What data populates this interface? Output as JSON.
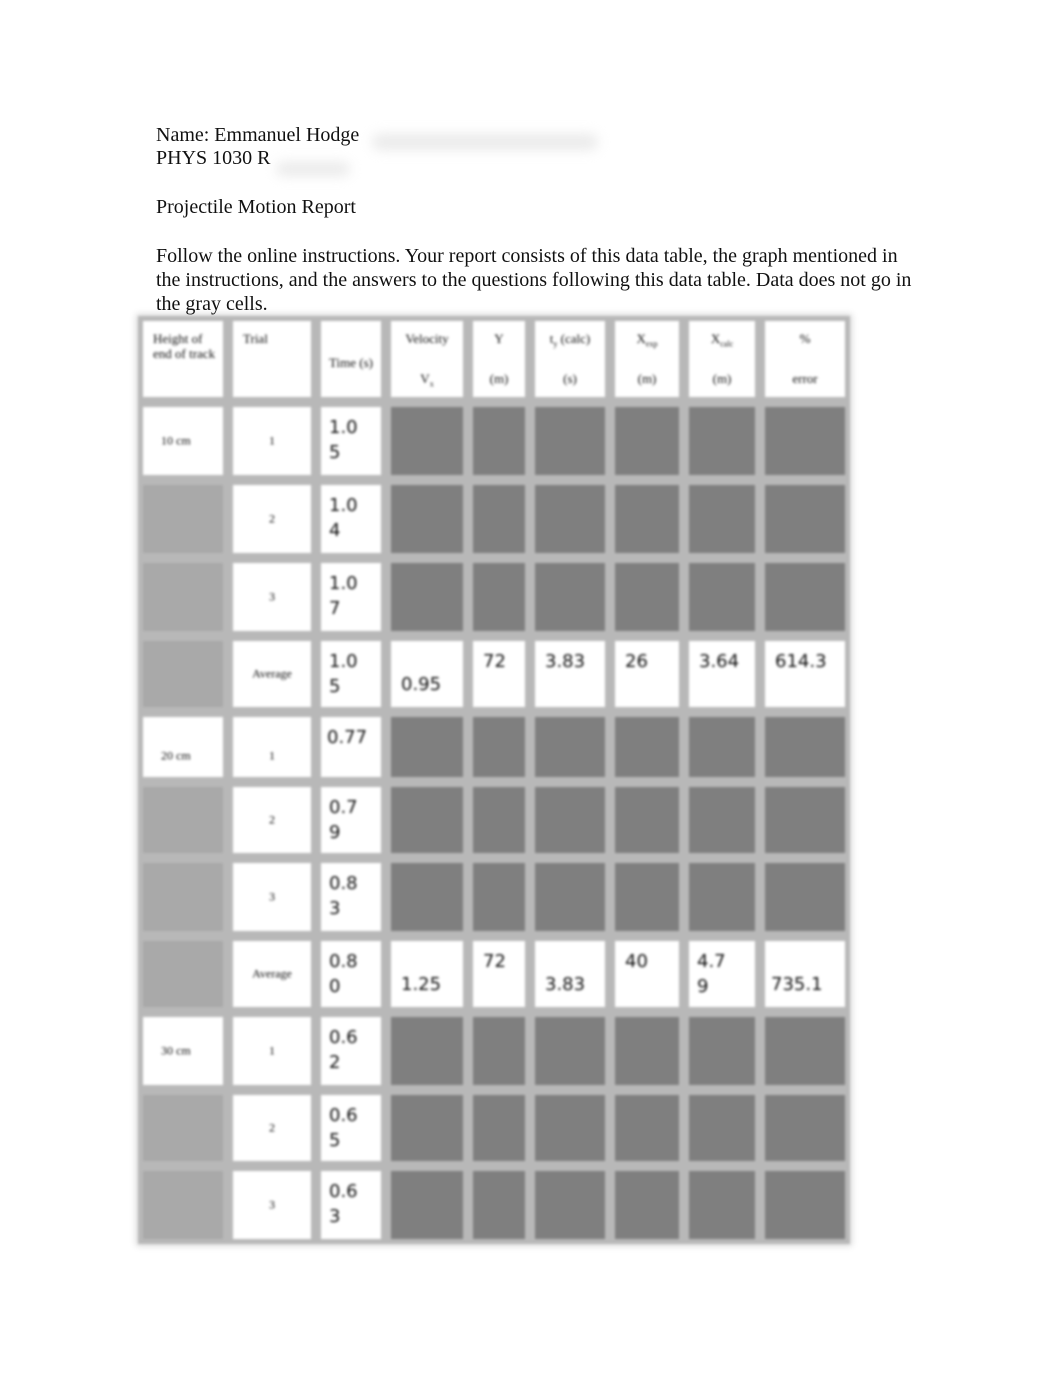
{
  "header": {
    "name_line": "Name: Emmanuel Hodge",
    "course_line": "PHYS 1030 R"
  },
  "title": "Projectile Motion Report",
  "intro": "Follow the online instructions.  Your report consists of this data table, the graph mentioned in the instructions, and the answers to the questions following this data table.  Data does not go in the gray cells.",
  "table": {
    "headers": {
      "height": "Height of end of track",
      "trial": "Trial",
      "time": "Time (s)",
      "velocity_top": "Velocity",
      "velocity_sym": "V",
      "velocity_sub": "x",
      "y_top": "Y",
      "y_unit": "(m)",
      "ty_sym": "t",
      "ty_sub": "y",
      "ty_rest": " (calc)",
      "ty_unit": "(s)",
      "xexp_sym": "X",
      "xexp_sub": "exp",
      "xexp_unit": "(m)",
      "xcalc_sym": "X",
      "xcalc_sub": "calc",
      "xcalc_unit": "(m)",
      "err_top": "%",
      "err_unit": "error"
    },
    "groups": [
      {
        "height": "10 cm",
        "trials": [
          {
            "trial": "1",
            "time": "1.05"
          },
          {
            "trial": "2",
            "time": "1.04"
          },
          {
            "trial": "3",
            "time": "1.07"
          }
        ],
        "average": {
          "label": "Average",
          "time": "1.05",
          "velocity": "0.95",
          "y": "72",
          "ty": "3.83",
          "xexp": "26",
          "xcalc": "3.64",
          "error": "614.3"
        }
      },
      {
        "height": "20 cm",
        "trials": [
          {
            "trial": "1",
            "time": "0.77"
          },
          {
            "trial": "2",
            "time": "0.79"
          },
          {
            "trial": "3",
            "time": "0.83"
          }
        ],
        "average": {
          "label": "Average",
          "time": "0.80",
          "velocity": "1.25",
          "y": "72",
          "ty": "3.83",
          "xexp": "40",
          "xcalc": "4.79",
          "error": "735.1"
        }
      },
      {
        "height": "30 cm",
        "trials": [
          {
            "trial": "1",
            "time": "0.62"
          },
          {
            "trial": "2",
            "time": "0.65"
          },
          {
            "trial": "3",
            "time": "0.63"
          }
        ]
      }
    ]
  }
}
